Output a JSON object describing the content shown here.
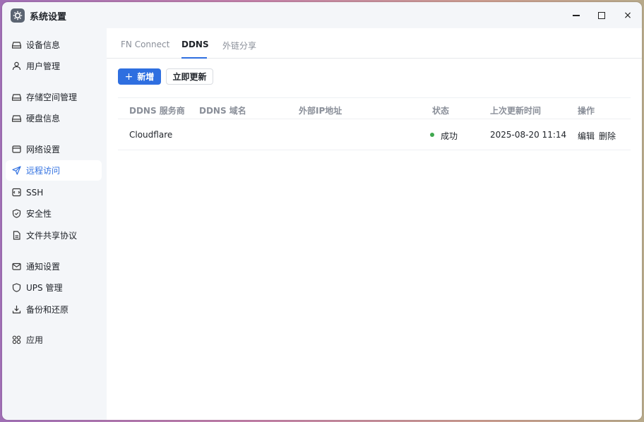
{
  "window": {
    "title": "系统设置",
    "controls": {
      "minimize": "minimize",
      "maximize": "maximize",
      "close": "×"
    }
  },
  "sidebar": {
    "items": [
      {
        "label": "设备信息",
        "icon": "hard-drive-icon"
      },
      {
        "label": "用户管理",
        "icon": "user-icon"
      },
      {
        "label": "存储空间管理",
        "icon": "storage-icon"
      },
      {
        "label": "硬盘信息",
        "icon": "disk-icon"
      },
      {
        "label": "网络设置",
        "icon": "network-icon"
      },
      {
        "label": "远程访问",
        "icon": "send-icon",
        "active": true
      },
      {
        "label": "SSH",
        "icon": "terminal-icon"
      },
      {
        "label": "安全性",
        "icon": "shield-icon"
      },
      {
        "label": "文件共享协议",
        "icon": "file-icon"
      },
      {
        "label": "通知设置",
        "icon": "mail-icon"
      },
      {
        "label": "UPS 管理",
        "icon": "shield-outline-icon"
      },
      {
        "label": "备份和还原",
        "icon": "download-icon"
      },
      {
        "label": "应用",
        "icon": "apps-icon"
      }
    ]
  },
  "tabs": [
    {
      "label": "FN Connect"
    },
    {
      "label": "DDNS",
      "active": true
    },
    {
      "label": "外链分享"
    }
  ],
  "toolbar": {
    "add_label": "新增",
    "refresh_label": "立即更新"
  },
  "table": {
    "headers": [
      "DDNS 服务商",
      "DDNS 域名",
      "外部IP地址",
      "状态",
      "上次更新时间",
      "操作"
    ],
    "rows": [
      {
        "provider": "Cloudflare",
        "domain": "",
        "external_ip": "",
        "status": "成功",
        "status_color": "#3fa84e",
        "updated": "2025-08-20 11:14",
        "actions": [
          "编辑",
          "删除"
        ]
      }
    ]
  },
  "colors": {
    "accent": "#2f6fe0",
    "success": "#3fa84e"
  }
}
